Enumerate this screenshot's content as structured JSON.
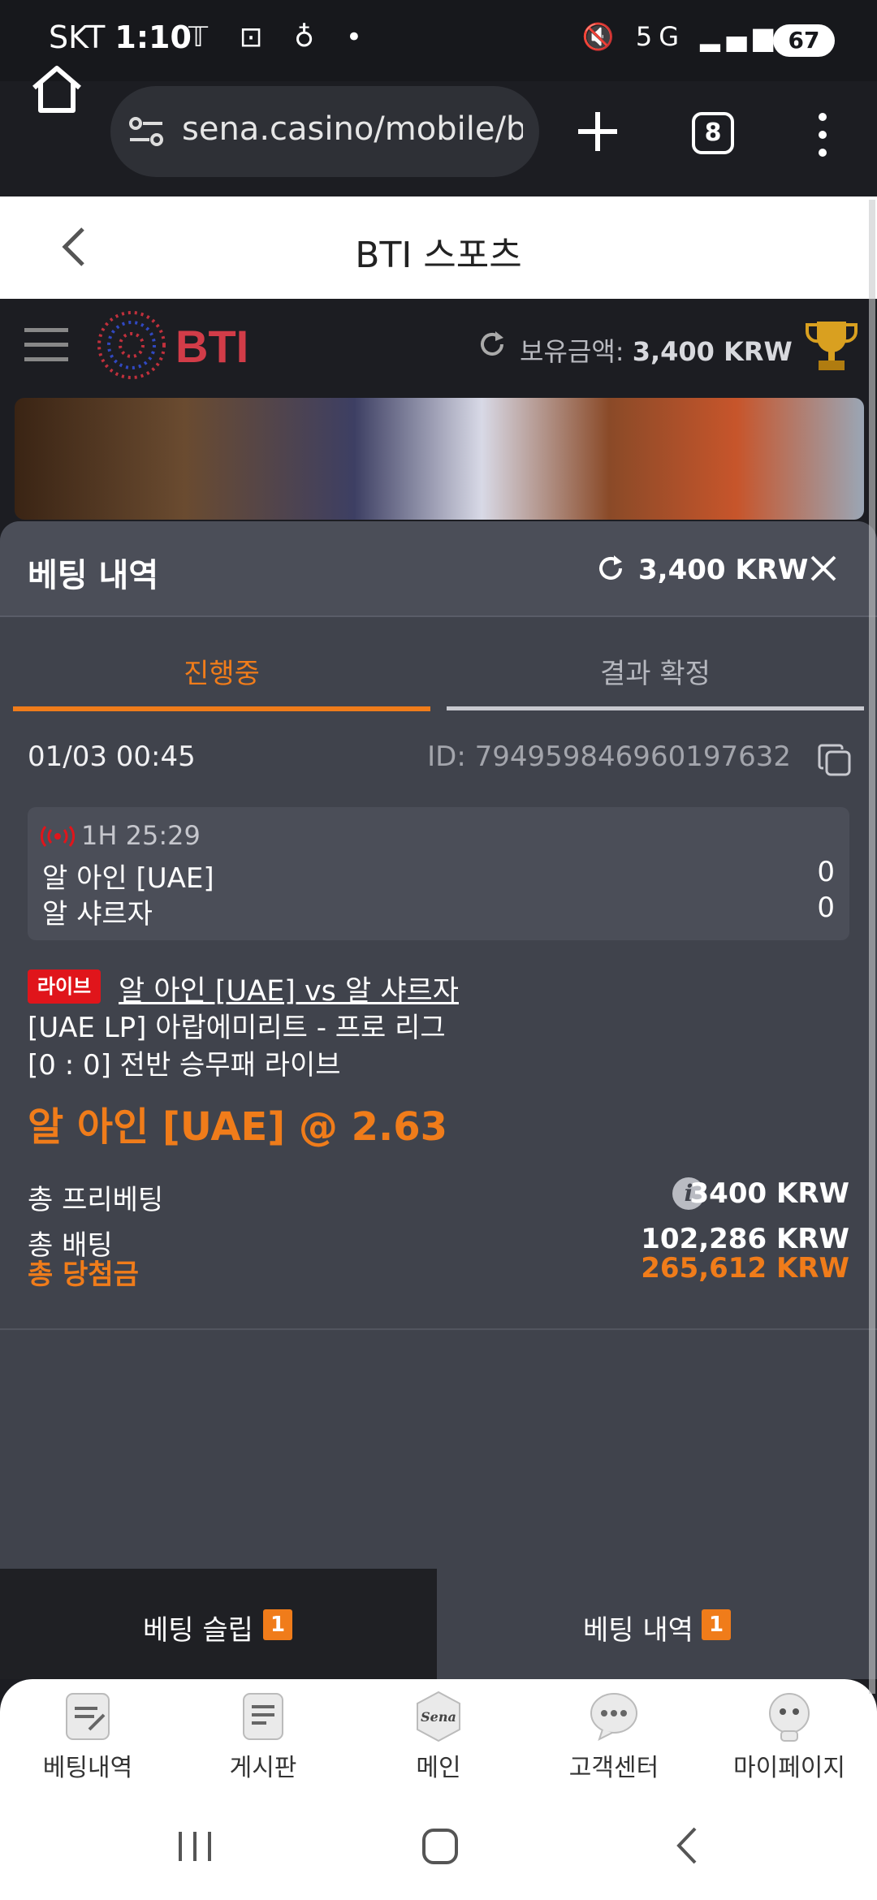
{
  "status_bar": {
    "carrier": "SKT",
    "time": "1:10",
    "network": "5G",
    "battery": "67"
  },
  "browser": {
    "url": "sena.casino/mobile/bti",
    "tab_count": "8"
  },
  "page": {
    "title": "BTI 스포츠"
  },
  "app_header": {
    "logo_text": "BTI",
    "balance_label": "보유금액:",
    "balance_value": "3,400 KRW"
  },
  "panel": {
    "title": "베팅 내역",
    "balance": "3,400 KRW",
    "tabs": [
      {
        "label": "진행중",
        "active": true
      },
      {
        "label": "결과 확정",
        "active": false
      }
    ]
  },
  "bet": {
    "datetime": "01/03 00:45",
    "id_label": "ID:",
    "id": "794959846960197632",
    "live_clock": "1H 25:29",
    "team_home": "알 아인 [UAE]",
    "team_away": "알 샤르자",
    "score_home": "0",
    "score_away": "0",
    "live_badge": "라이브",
    "match": "알 아인 [UAE] vs 알 샤르자",
    "league": "[UAE LP] 아랍에미리트 - 프로 리그",
    "market": "[0 : 0] 전반 승무패 라이브",
    "selection": "알 아인 [UAE] @ 2.63",
    "rows": [
      {
        "label": "총 프리베팅",
        "value": "3400 KRW"
      },
      {
        "label": "총 배팅",
        "value": "102,286 KRW"
      },
      {
        "label": "총 당첨금",
        "value": "265,612 KRW"
      }
    ]
  },
  "bottom_tabs": {
    "betslip_label": "베팅 슬립",
    "betslip_count": "1",
    "history_label": "베팅 내역",
    "history_count": "1"
  },
  "nav": {
    "items": [
      {
        "label": "베팅내역",
        "icon": "bet-history-icon"
      },
      {
        "label": "게시판",
        "icon": "board-icon"
      },
      {
        "label": "메인",
        "icon": "sena-logo-icon"
      },
      {
        "label": "고객센터",
        "icon": "chat-icon"
      },
      {
        "label": "마이페이지",
        "icon": "profile-icon"
      }
    ],
    "main_logo_text": "Sena"
  },
  "colors": {
    "accent": "#f07c1a",
    "live_red": "#e0151b",
    "panel_bg": "#40434c"
  }
}
